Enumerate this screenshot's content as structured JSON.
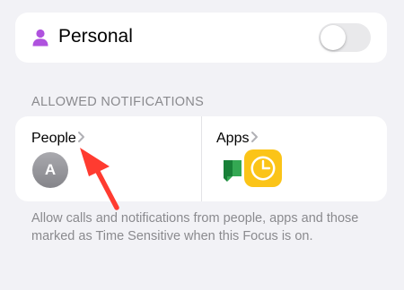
{
  "focus": {
    "name": "Personal",
    "icon": "person-icon",
    "icon_color": "#af52de",
    "enabled": false
  },
  "allowed_notifications": {
    "header": "ALLOWED NOTIFICATIONS",
    "people": {
      "label": "People",
      "chevron": "chevron-right-icon",
      "contacts": [
        {
          "initial": "A"
        }
      ]
    },
    "apps": {
      "label": "Apps",
      "chevron": "chevron-right-icon",
      "icons": [
        "google-chat-icon",
        "clock-app-icon"
      ]
    }
  },
  "footer_text": "Allow calls and notifications from people, apps and those marked as Time Sensitive when this Focus is on.",
  "annotation": {
    "icon": "red-arrow-icon",
    "color": "#ff3b30"
  }
}
